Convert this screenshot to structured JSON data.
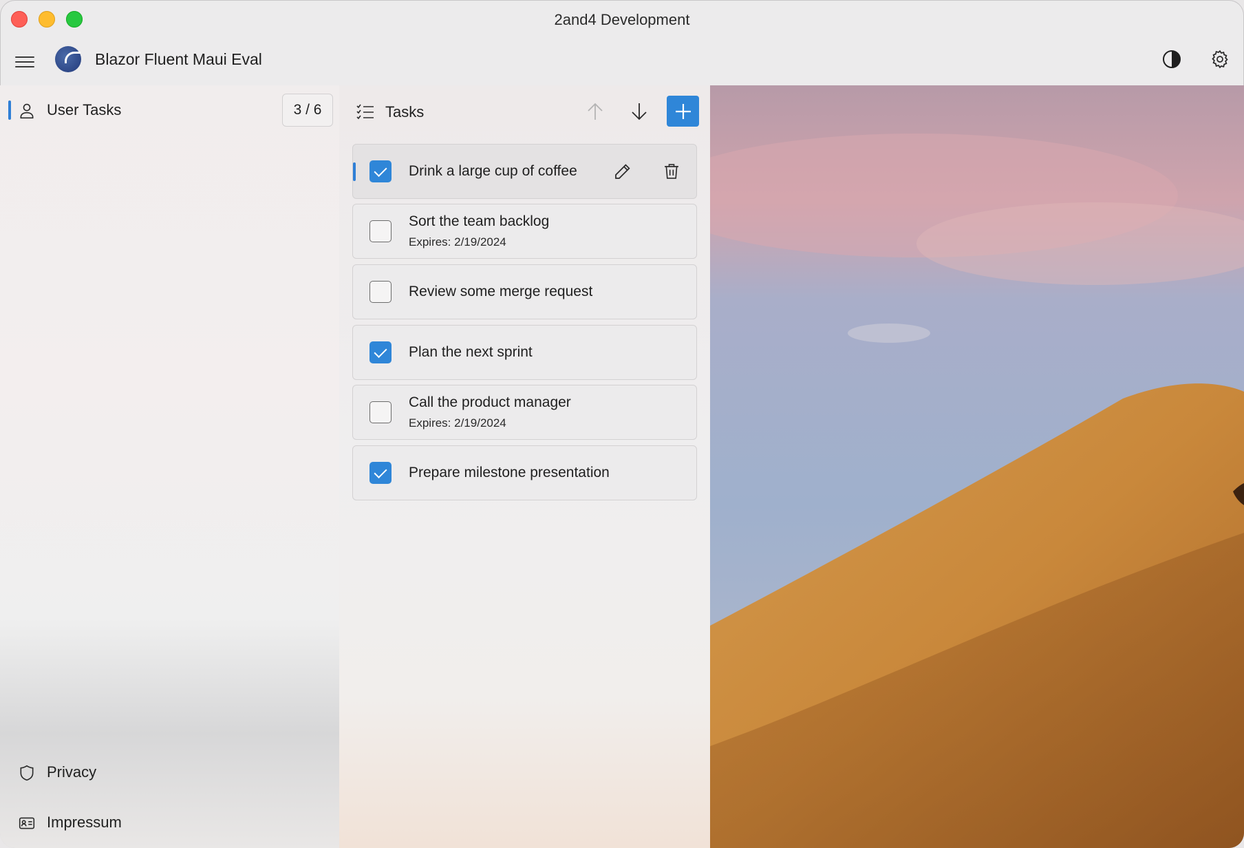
{
  "window": {
    "title": "2and4 Development"
  },
  "app": {
    "name": "Blazor Fluent Maui Eval"
  },
  "sidebar": {
    "items": [
      {
        "label": "User Tasks",
        "icon": "person-icon",
        "badge": "3 / 6",
        "active": true
      },
      {
        "label": "Privacy",
        "icon": "shield-icon"
      },
      {
        "label": "Impressum",
        "icon": "contact-card-icon"
      }
    ]
  },
  "tasks": {
    "title": "Tasks",
    "items": [
      {
        "label": "Drink a large cup of coffee",
        "checked": true,
        "selected": true,
        "expires": ""
      },
      {
        "label": "Sort the team backlog",
        "checked": false,
        "expires": "Expires: 2/19/2024"
      },
      {
        "label": "Review some merge request",
        "checked": false,
        "expires": ""
      },
      {
        "label": "Plan the next sprint",
        "checked": true,
        "expires": ""
      },
      {
        "label": "Call the product manager",
        "checked": false,
        "expires": "Expires: 2/19/2024"
      },
      {
        "label": "Prepare milestone presentation",
        "checked": true,
        "expires": ""
      }
    ]
  },
  "colors": {
    "accent": "#2f86d8",
    "close": "#fe5f57",
    "minimize": "#febc2e",
    "maximize": "#28c840"
  }
}
